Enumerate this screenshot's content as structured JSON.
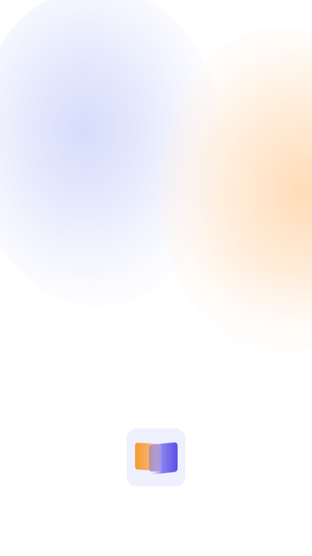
{
  "screen": {
    "type": "splash",
    "background_colors": {
      "base": "#ffffff",
      "lavender_glow": "#d4dafc",
      "peach_glow": "#ffdab4"
    }
  },
  "app_icon": {
    "icon": "app-logo-icon",
    "tile_color": "#eef0fe",
    "front_card_color": "#f7a13c",
    "back_card_color": "#6259e8"
  }
}
